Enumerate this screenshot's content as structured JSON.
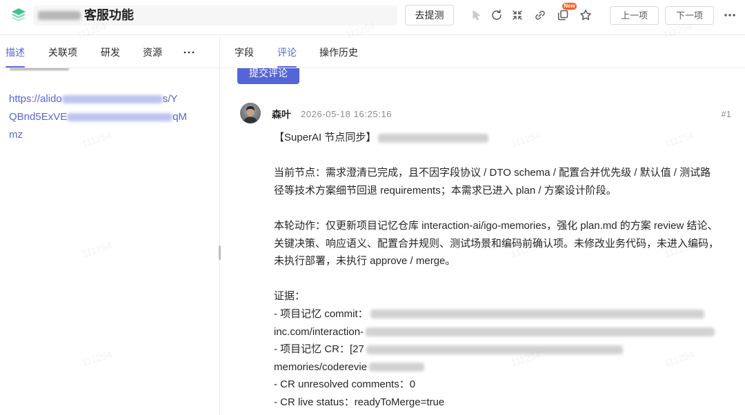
{
  "colors": {
    "accent": "#5565d8",
    "text": "#262626",
    "muted": "#8c8c8c",
    "border": "#ebebeb",
    "badge": "#ff5b1e",
    "logo": "#3ec58f"
  },
  "icons": {
    "logo": "layers-logo-icon",
    "pointer": "pointer-icon",
    "refresh": "refresh-icon",
    "fullscreen": "fullscreen-icon",
    "link": "link-icon",
    "copy": "copy-icon",
    "star": "star-icon",
    "more": "more-icon",
    "more_tabs": "more-tabs-icon"
  },
  "header": {
    "title": "客服功能",
    "submit_test_label": "去提测",
    "new_badge": "New",
    "prev_label": "上一项",
    "next_label": "下一项"
  },
  "left_panel": {
    "tabs": [
      {
        "label": "描述",
        "active": true
      },
      {
        "label": "关联项",
        "active": false
      },
      {
        "label": "研发",
        "active": false
      },
      {
        "label": "资源",
        "active": false
      }
    ],
    "description": {
      "link_lines": [
        [
          "https://alido",
          "s/Y"
        ],
        [
          "QBnd5ExVE",
          "qM"
        ],
        [
          "mz"
        ]
      ]
    }
  },
  "right_panel": {
    "tabs": [
      {
        "label": "字段",
        "active": false
      },
      {
        "label": "评论",
        "active": true
      },
      {
        "label": "操作历史",
        "active": false
      }
    ],
    "submit_comment_label": "提交评论",
    "comment": {
      "author": "森叶",
      "time": "2026-05-18 16:25:16",
      "number": "#1",
      "heading": "【SuperAI 节点同步】",
      "current_node_lines": [
        "当前节点：需求澄清已完成，且不因字段协议 / DTO schema / 配置合并优先级 / 默认值 / 测试路",
        "径等技术方案细节回退 requirements；本需求已进入 plan / 方案设计阶段。"
      ],
      "action_lines": [
        "本轮动作：仅更新项目记忆仓库 interaction-ai/igo-memories，强化 plan.md 的方案 review 结论、",
        "关键决策、响应语义、配置合并规则、测试场景和编码前确认项。未修改业务代码，未进入编码，",
        "未执行部署，未执行 approve / merge。"
      ],
      "evidence_label": "证据：",
      "evidence_lines": [
        "- 项目记忆 commit：",
        "inc.com/interaction-",
        "- 项目记忆 CR：[27",
        "memories/coderevie",
        "- CR unresolved comments：0",
        "- CR live status：readyToMerge=true"
      ]
    }
  },
  "watermark": "111254"
}
